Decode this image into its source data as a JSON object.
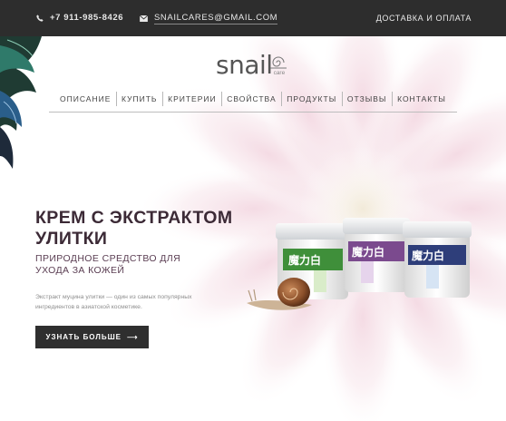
{
  "topbar": {
    "phone": "+7 911-985-8426",
    "email": "SNAILCARES@GMAIL.COM",
    "delivery": "ДОСТАВКА И ОПЛАТА"
  },
  "logo": {
    "word": "snail",
    "care": "care"
  },
  "nav": {
    "items": [
      "ОПИСАНИЕ",
      "КУПИТЬ",
      "КРИТЕРИИ",
      "СВОЙСТВА",
      "ПРОДУКТЫ",
      "ОТЗЫВЫ",
      "КОНТАКТЫ"
    ]
  },
  "hero": {
    "title": "КРЕМ С ЭКСТРАКТОМ УЛИТКИ",
    "subtitle": "ПРИРОДНОЕ СРЕДСТВО ДЛЯ УХОДА ЗА КОЖЕЙ",
    "description": "Экстракт муцина улитки — один из самых популярных ингредиентов в азиатской косметике.",
    "button_label": "УЗНАТЬ БОЛЬШЕ",
    "button_arrow": "⟶"
  },
  "product": {
    "jar_label": "魔力白"
  },
  "colors": {
    "topbar_bg": "#2d2d2d",
    "title": "#3c2a36",
    "button_bg": "#2f2f2f",
    "jar_green": "#3f8f3a",
    "jar_purple": "#7b4a8e",
    "jar_blue": "#2e3e7a"
  }
}
